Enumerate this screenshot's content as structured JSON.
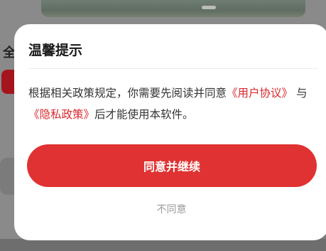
{
  "background": {
    "left_heading_fragment": "全"
  },
  "dialog": {
    "title": "温馨提示",
    "body_prefix": "根据相关政策规定，你需要先阅读并同意",
    "user_agreement_link": "《用户协议》",
    "conjunction": "与",
    "privacy_policy_link": "《隐私政策》",
    "body_suffix": "后才能使用本软件。",
    "agree_button": "同意并继续",
    "disagree_button": "不同意"
  },
  "colors": {
    "accent": "#e03232",
    "link": "#d8282c"
  }
}
